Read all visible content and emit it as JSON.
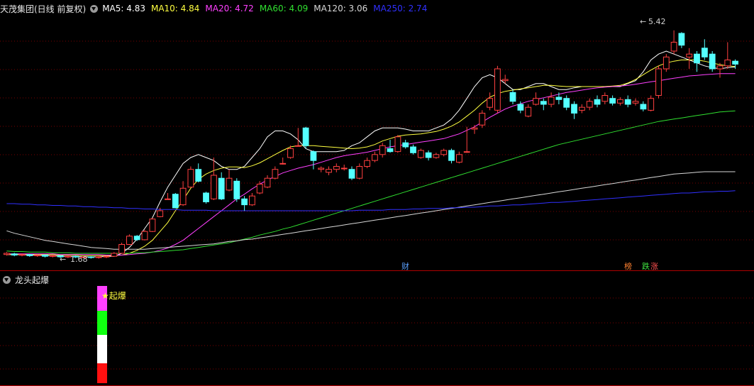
{
  "header": {
    "title": "天茂集团(日线 前复权)",
    "ma_items": [
      {
        "label": "MA5: 4.83",
        "color": "#ffffff"
      },
      {
        "label": "MA10: 4.84",
        "color": "#ffff40"
      },
      {
        "label": "MA20: 4.72",
        "color": "#ff40ff"
      },
      {
        "label": "MA60: 4.09",
        "color": "#30e030"
      },
      {
        "label": "MA120: 3.06",
        "color": "#d8d8d8"
      },
      {
        "label": "MA250: 2.74",
        "color": "#3030ff"
      }
    ]
  },
  "sub_panel": {
    "title": "龙头起爆",
    "signal_label": "★起爆"
  },
  "colors": {
    "up": "#ff4040",
    "down": "#54ffff",
    "grid": "#7a0000",
    "border": "#b00000"
  },
  "chart_data": {
    "type": "candlestick",
    "price_range": [
      1.5,
      5.7
    ],
    "annotations": {
      "high_label": "5.42",
      "low_label": "1.68"
    },
    "markers": [
      "财",
      "榜",
      "跌",
      "涨"
    ],
    "series": [
      {
        "name": "MA5",
        "values": [
          1.66,
          1.66,
          1.66,
          1.65,
          1.65,
          1.64,
          1.64,
          1.63,
          1.63,
          1.63,
          1.62,
          1.62,
          1.62,
          1.63,
          1.63,
          1.68,
          1.78,
          1.92,
          2.1,
          2.28,
          2.55,
          2.8,
          3.0,
          3.2,
          3.3,
          3.35,
          3.3,
          3.25,
          3.15,
          3.1,
          3.1,
          3.15,
          3.3,
          3.45,
          3.65,
          3.75,
          3.75,
          3.7,
          3.6,
          3.45,
          3.4,
          3.4,
          3.4,
          3.4,
          3.42,
          3.5,
          3.55,
          3.65,
          3.75,
          3.8,
          3.8,
          3.8,
          3.78,
          3.75,
          3.75,
          3.75,
          3.8,
          3.85,
          3.95,
          4.1,
          4.3,
          4.5,
          4.65,
          4.7,
          4.65,
          4.55,
          4.45,
          4.45,
          4.5,
          4.55,
          4.55,
          4.5,
          4.45,
          4.45,
          4.48,
          4.5,
          4.5,
          4.5,
          4.5,
          4.5,
          4.5,
          4.55,
          4.6,
          4.75,
          4.95,
          5.05,
          5.1,
          5.05,
          5.0,
          4.95,
          4.9,
          4.85,
          4.82,
          4.8,
          4.82,
          4.83
        ]
      },
      {
        "name": "MA10",
        "values": [
          1.66,
          1.66,
          1.66,
          1.66,
          1.66,
          1.66,
          1.66,
          1.65,
          1.65,
          1.65,
          1.64,
          1.64,
          1.64,
          1.64,
          1.64,
          1.65,
          1.68,
          1.73,
          1.8,
          1.9,
          2.05,
          2.2,
          2.4,
          2.58,
          2.78,
          2.93,
          3.02,
          3.08,
          3.12,
          3.14,
          3.14,
          3.13,
          3.16,
          3.21,
          3.28,
          3.35,
          3.42,
          3.48,
          3.5,
          3.5,
          3.5,
          3.49,
          3.48,
          3.47,
          3.46,
          3.45,
          3.46,
          3.48,
          3.52,
          3.58,
          3.62,
          3.66,
          3.68,
          3.69,
          3.7,
          3.72,
          3.74,
          3.78,
          3.83,
          3.9,
          4.0,
          4.1,
          4.22,
          4.32,
          4.38,
          4.42,
          4.44,
          4.46,
          4.48,
          4.5,
          4.52,
          4.52,
          4.51,
          4.5,
          4.5,
          4.5,
          4.5,
          4.5,
          4.5,
          4.51,
          4.52,
          4.56,
          4.62,
          4.7,
          4.78,
          4.85,
          4.9,
          4.93,
          4.95,
          4.95,
          4.95,
          4.93,
          4.9,
          4.87,
          4.85,
          4.84
        ]
      },
      {
        "name": "MA20",
        "values": [
          1.67,
          1.67,
          1.67,
          1.67,
          1.67,
          1.67,
          1.67,
          1.66,
          1.66,
          1.66,
          1.66,
          1.66,
          1.66,
          1.65,
          1.65,
          1.65,
          1.66,
          1.67,
          1.68,
          1.7,
          1.73,
          1.77,
          1.83,
          1.9,
          2.0,
          2.1,
          2.2,
          2.3,
          2.4,
          2.5,
          2.6,
          2.68,
          2.77,
          2.85,
          2.92,
          2.98,
          3.04,
          3.08,
          3.12,
          3.15,
          3.18,
          3.22,
          3.26,
          3.3,
          3.33,
          3.35,
          3.37,
          3.39,
          3.42,
          3.45,
          3.48,
          3.5,
          3.52,
          3.54,
          3.56,
          3.58,
          3.6,
          3.62,
          3.66,
          3.7,
          3.76,
          3.82,
          3.9,
          3.98,
          4.05,
          4.12,
          4.17,
          4.21,
          4.25,
          4.28,
          4.31,
          4.34,
          4.37,
          4.4,
          4.42,
          4.44,
          4.46,
          4.48,
          4.49,
          4.5,
          4.51,
          4.52,
          4.54,
          4.56,
          4.58,
          4.6,
          4.62,
          4.64,
          4.66,
          4.68,
          4.69,
          4.7,
          4.71,
          4.72,
          4.72,
          4.72
        ]
      },
      {
        "name": "MA60",
        "values": [
          1.72,
          1.71,
          1.71,
          1.7,
          1.7,
          1.7,
          1.69,
          1.69,
          1.69,
          1.68,
          1.68,
          1.68,
          1.68,
          1.68,
          1.68,
          1.68,
          1.68,
          1.69,
          1.69,
          1.7,
          1.71,
          1.72,
          1.73,
          1.74,
          1.76,
          1.78,
          1.8,
          1.82,
          1.84,
          1.86,
          1.89,
          1.92,
          1.95,
          1.99,
          2.02,
          2.05,
          2.09,
          2.12,
          2.16,
          2.2,
          2.24,
          2.28,
          2.32,
          2.36,
          2.4,
          2.44,
          2.48,
          2.52,
          2.56,
          2.6,
          2.64,
          2.68,
          2.72,
          2.76,
          2.8,
          2.84,
          2.88,
          2.92,
          2.96,
          3.0,
          3.04,
          3.08,
          3.12,
          3.16,
          3.2,
          3.24,
          3.28,
          3.32,
          3.36,
          3.4,
          3.44,
          3.48,
          3.52,
          3.55,
          3.58,
          3.61,
          3.64,
          3.67,
          3.7,
          3.73,
          3.76,
          3.79,
          3.82,
          3.85,
          3.88,
          3.91,
          3.93,
          3.95,
          3.97,
          3.99,
          4.01,
          4.03,
          4.05,
          4.07,
          4.08,
          4.09
        ]
      },
      {
        "name": "MA120",
        "values": [
          2.06,
          2.02,
          1.99,
          1.96,
          1.93,
          1.9,
          1.88,
          1.86,
          1.84,
          1.82,
          1.8,
          1.78,
          1.77,
          1.76,
          1.75,
          1.75,
          1.75,
          1.75,
          1.75,
          1.76,
          1.77,
          1.78,
          1.79,
          1.8,
          1.81,
          1.82,
          1.83,
          1.84,
          1.86,
          1.88,
          1.89,
          1.91,
          1.92,
          1.94,
          1.96,
          1.98,
          2.0,
          2.02,
          2.04,
          2.06,
          2.08,
          2.1,
          2.12,
          2.14,
          2.16,
          2.18,
          2.2,
          2.22,
          2.24,
          2.26,
          2.28,
          2.3,
          2.32,
          2.34,
          2.36,
          2.38,
          2.4,
          2.42,
          2.44,
          2.46,
          2.48,
          2.5,
          2.52,
          2.54,
          2.56,
          2.58,
          2.6,
          2.62,
          2.64,
          2.66,
          2.68,
          2.7,
          2.72,
          2.74,
          2.76,
          2.78,
          2.8,
          2.82,
          2.84,
          2.86,
          2.88,
          2.9,
          2.92,
          2.94,
          2.96,
          2.98,
          3.0,
          3.02,
          3.03,
          3.04,
          3.05,
          3.06,
          3.06,
          3.06,
          3.06,
          3.06
        ]
      },
      {
        "name": "MA250",
        "values": [
          2.52,
          2.52,
          2.51,
          2.51,
          2.5,
          2.5,
          2.49,
          2.49,
          2.48,
          2.48,
          2.47,
          2.47,
          2.46,
          2.46,
          2.45,
          2.45,
          2.44,
          2.44,
          2.43,
          2.43,
          2.42,
          2.42,
          2.42,
          2.41,
          2.41,
          2.41,
          2.41,
          2.4,
          2.4,
          2.4,
          2.4,
          2.4,
          2.4,
          2.4,
          2.4,
          2.4,
          2.4,
          2.4,
          2.4,
          2.4,
          2.4,
          2.4,
          2.4,
          2.4,
          2.4,
          2.4,
          2.41,
          2.41,
          2.41,
          2.41,
          2.42,
          2.42,
          2.42,
          2.43,
          2.43,
          2.44,
          2.44,
          2.44,
          2.45,
          2.45,
          2.46,
          2.46,
          2.47,
          2.48,
          2.48,
          2.49,
          2.5,
          2.5,
          2.51,
          2.52,
          2.53,
          2.54,
          2.54,
          2.55,
          2.56,
          2.57,
          2.58,
          2.59,
          2.6,
          2.61,
          2.62,
          2.63,
          2.64,
          2.65,
          2.66,
          2.67,
          2.68,
          2.69,
          2.7,
          2.7,
          2.71,
          2.72,
          2.72,
          2.73,
          2.73,
          2.74
        ]
      }
    ],
    "candles": [
      [
        1.66,
        1.68,
        1.7,
        1.64
      ],
      [
        1.67,
        1.65,
        1.69,
        1.63
      ],
      [
        1.65,
        1.66,
        1.68,
        1.63
      ],
      [
        1.66,
        1.64,
        1.67,
        1.62
      ],
      [
        1.64,
        1.65,
        1.66,
        1.62
      ],
      [
        1.65,
        1.63,
        1.66,
        1.61
      ],
      [
        1.63,
        1.64,
        1.65,
        1.61
      ],
      [
        1.64,
        1.62,
        1.65,
        1.6
      ],
      [
        1.62,
        1.63,
        1.64,
        1.6
      ],
      [
        1.63,
        1.62,
        1.64,
        1.6
      ],
      [
        1.62,
        1.62,
        1.63,
        1.6
      ],
      [
        1.62,
        1.61,
        1.63,
        1.59
      ],
      [
        1.61,
        1.62,
        1.63,
        1.59
      ],
      [
        1.62,
        1.63,
        1.64,
        1.6
      ],
      [
        1.63,
        1.68,
        1.7,
        1.62
      ],
      [
        1.68,
        1.83,
        1.86,
        1.67
      ],
      [
        1.83,
        1.97,
        2.0,
        1.82
      ],
      [
        1.97,
        1.91,
        1.99,
        1.89
      ],
      [
        1.91,
        2.05,
        2.08,
        1.9
      ],
      [
        2.05,
        2.26,
        2.28,
        2.04
      ],
      [
        2.3,
        2.4,
        2.45,
        2.29
      ],
      [
        2.6,
        2.6,
        2.7,
        2.59
      ],
      [
        2.68,
        2.45,
        2.7,
        2.44
      ],
      [
        2.5,
        2.78,
        2.9,
        2.48
      ],
      [
        2.8,
        3.1,
        3.15,
        2.79
      ],
      [
        3.1,
        2.9,
        3.2,
        2.88
      ],
      [
        2.7,
        2.55,
        2.72,
        2.52
      ],
      [
        2.6,
        3.0,
        3.3,
        2.58
      ],
      [
        2.95,
        2.6,
        3.05,
        2.58
      ],
      [
        2.75,
        2.95,
        3.1,
        2.73
      ],
      [
        2.9,
        2.6,
        2.95,
        2.55
      ],
      [
        2.6,
        2.5,
        2.65,
        2.4
      ],
      [
        2.5,
        2.65,
        2.7,
        2.48
      ],
      [
        2.7,
        2.85,
        2.9,
        2.68
      ],
      [
        2.8,
        2.95,
        3.0,
        2.78
      ],
      [
        2.95,
        3.1,
        3.15,
        2.93
      ],
      [
        3.2,
        3.2,
        3.3,
        3.18
      ],
      [
        3.3,
        3.45,
        3.5,
        3.28
      ],
      [
        3.5,
        3.5,
        3.8,
        3.49
      ],
      [
        3.8,
        3.5,
        3.82,
        3.45
      ],
      [
        3.4,
        3.25,
        3.42,
        3.1
      ],
      [
        3.1,
        3.12,
        3.15,
        3.05
      ],
      [
        3.05,
        3.1,
        3.15,
        3.0
      ],
      [
        3.1,
        3.15,
        3.2,
        3.05
      ],
      [
        3.12,
        3.12,
        3.18,
        3.08
      ],
      [
        3.1,
        2.95,
        3.15,
        2.92
      ],
      [
        2.95,
        3.15,
        3.2,
        2.93
      ],
      [
        3.15,
        3.25,
        3.3,
        3.12
      ],
      [
        3.25,
        3.35,
        3.4,
        3.22
      ],
      [
        3.35,
        3.5,
        3.55,
        3.3
      ],
      [
        3.45,
        3.4,
        3.6,
        3.38
      ],
      [
        3.4,
        3.65,
        3.68,
        3.38
      ],
      [
        3.55,
        3.48,
        3.6,
        3.45
      ],
      [
        3.48,
        3.38,
        3.52,
        3.35
      ],
      [
        3.3,
        3.42,
        3.45,
        3.28
      ],
      [
        3.38,
        3.3,
        3.42,
        3.25
      ],
      [
        3.3,
        3.35,
        3.38,
        3.28
      ],
      [
        3.35,
        3.42,
        3.45,
        3.32
      ],
      [
        3.42,
        3.25,
        3.45,
        3.2
      ],
      [
        3.22,
        3.35,
        3.4,
        3.2
      ],
      [
        3.4,
        3.4,
        3.82,
        3.38
      ],
      [
        3.78,
        3.8,
        3.85,
        3.7
      ],
      [
        3.85,
        4.05,
        4.1,
        3.8
      ],
      [
        4.15,
        4.3,
        4.4,
        4.1
      ],
      [
        4.1,
        4.8,
        4.85,
        4.05
      ],
      [
        4.6,
        4.62,
        4.7,
        4.55
      ],
      [
        4.4,
        4.25,
        4.45,
        4.2
      ],
      [
        4.2,
        4.1,
        4.25,
        4.05
      ],
      [
        4.0,
        4.15,
        4.2,
        3.98
      ],
      [
        4.2,
        4.3,
        4.4,
        4.18
      ],
      [
        4.25,
        4.2,
        4.3,
        4.1
      ],
      [
        4.2,
        4.32,
        4.4,
        4.15
      ],
      [
        4.32,
        4.28,
        4.4,
        4.2
      ],
      [
        4.3,
        4.15,
        4.35,
        4.1
      ],
      [
        4.2,
        4.05,
        4.25,
        3.95
      ],
      [
        4.1,
        4.15,
        4.2,
        4.05
      ],
      [
        4.15,
        4.25,
        4.3,
        4.1
      ],
      [
        4.28,
        4.2,
        4.35,
        4.15
      ],
      [
        4.25,
        4.35,
        4.4,
        4.2
      ],
      [
        4.3,
        4.22,
        4.35,
        4.18
      ],
      [
        4.22,
        4.28,
        4.32,
        4.18
      ],
      [
        4.28,
        4.2,
        4.35,
        4.15
      ],
      [
        4.22,
        4.25,
        4.3,
        4.18
      ],
      [
        4.2,
        4.12,
        4.25,
        4.08
      ],
      [
        4.1,
        4.3,
        4.35,
        4.08
      ],
      [
        4.35,
        4.8,
        4.85,
        4.3
      ],
      [
        4.8,
        5.0,
        5.05,
        4.75
      ],
      [
        5.1,
        5.25,
        5.45,
        5.05
      ],
      [
        5.4,
        5.2,
        5.42,
        5.15
      ],
      [
        5.0,
        5.05,
        5.15,
        4.8
      ],
      [
        5.05,
        4.9,
        5.1,
        4.75
      ],
      [
        5.15,
        5.0,
        5.3,
        4.95
      ],
      [
        5.05,
        4.8,
        5.1,
        4.75
      ],
      [
        4.8,
        4.85,
        4.9,
        4.65
      ],
      [
        4.85,
        4.95,
        5.25,
        4.8
      ],
      [
        4.93,
        4.88,
        4.96,
        4.8
      ]
    ]
  }
}
